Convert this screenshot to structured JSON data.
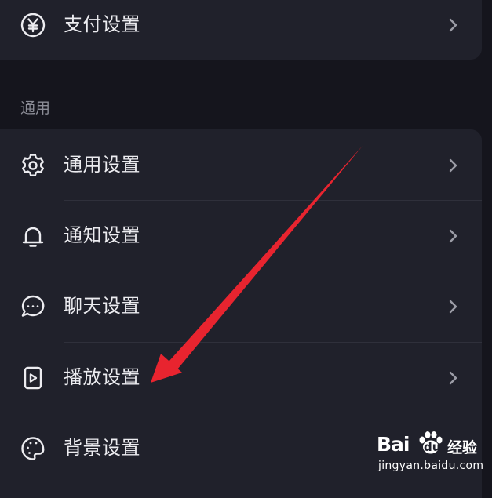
{
  "payment": {
    "label": "支付设置",
    "icon": "yuan-icon"
  },
  "section_general": {
    "title": "通用",
    "items": [
      {
        "label": "通用设置",
        "icon": "gear-icon"
      },
      {
        "label": "通知设置",
        "icon": "bell-icon"
      },
      {
        "label": "聊天设置",
        "icon": "chat-bubble-icon"
      },
      {
        "label": "播放设置",
        "icon": "play-file-icon"
      },
      {
        "label": "背景设置",
        "icon": "palette-icon"
      }
    ]
  },
  "watermark": {
    "logo_left": "Bai",
    "logo_right": "du",
    "product": "经验",
    "url": "jingyan.baidu.com"
  },
  "colors": {
    "background": "#15151d",
    "card": "#20212b",
    "text": "#ececf0",
    "muted": "#8c8d97",
    "annotation_arrow": "#e8242f"
  }
}
